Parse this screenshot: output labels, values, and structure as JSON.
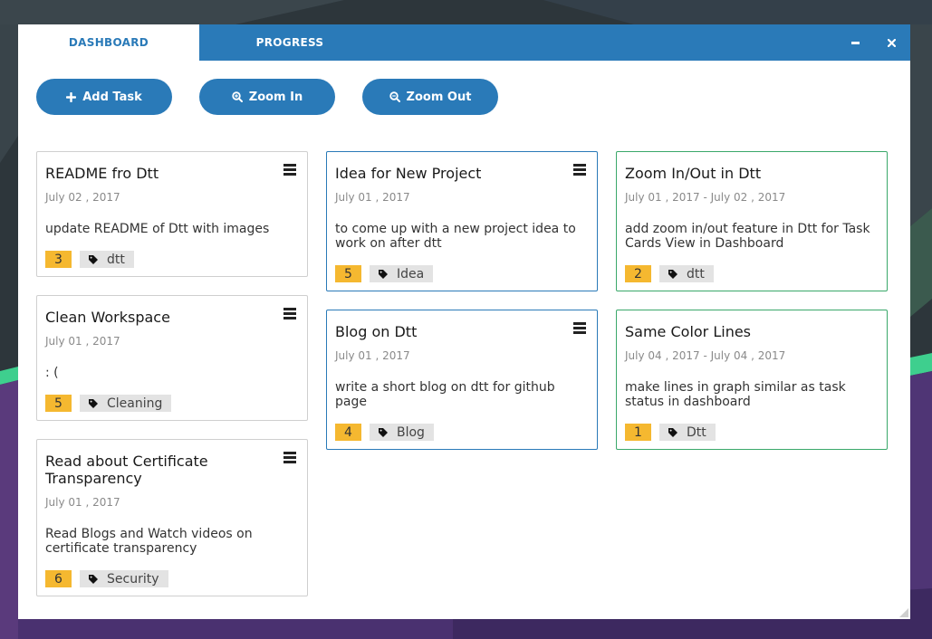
{
  "tabs": {
    "dashboard": "DASHBOARD",
    "progress": "PROGRESS"
  },
  "window_controls": {
    "minimize": "minimize-icon",
    "close": "close-icon"
  },
  "toolbar": {
    "add_task": "Add Task",
    "zoom_in": "Zoom In",
    "zoom_out": "Zoom Out"
  },
  "colors": {
    "accent": "#2a7ab8",
    "done_border": "#3aa86a",
    "priority": "#f5b830",
    "tag_bg": "#e3e3e3"
  },
  "columns": [
    {
      "status": "todo",
      "cards": [
        {
          "title": "README fro Dtt",
          "date": "July 02 , 2017",
          "desc": "update README of Dtt with images",
          "priority": "3",
          "tag": "dtt"
        },
        {
          "title": "Clean Workspace",
          "date": "July 01 , 2017",
          "desc": ": (",
          "priority": "5",
          "tag": "Cleaning"
        },
        {
          "title": "Read about Certificate Transparency",
          "date": "July 01 , 2017",
          "desc": "Read Blogs and Watch videos on certificate transparency",
          "priority": "6",
          "tag": "Security"
        }
      ]
    },
    {
      "status": "in-progress",
      "cards": [
        {
          "title": "Idea for New Project",
          "date": "July 01 , 2017",
          "desc": "to come up with a new project idea to work on after dtt",
          "priority": "5",
          "tag": "Idea"
        },
        {
          "title": "Blog on Dtt",
          "date": "July 01 , 2017",
          "desc": "write a short blog on dtt for github page",
          "priority": "4",
          "tag": "Blog"
        }
      ]
    },
    {
      "status": "done",
      "cards": [
        {
          "title": "Zoom In/Out in Dtt",
          "date": "July 01 , 2017 - July 02 , 2017",
          "desc": "add zoom in/out feature in Dtt for Task Cards View in Dashboard",
          "priority": "2",
          "tag": "dtt"
        },
        {
          "title": "Same Color Lines",
          "date": "July 04 , 2017 - July 04 , 2017",
          "desc": "make lines in graph similar as task status in dashboard",
          "priority": "1",
          "tag": "Dtt"
        }
      ]
    }
  ]
}
